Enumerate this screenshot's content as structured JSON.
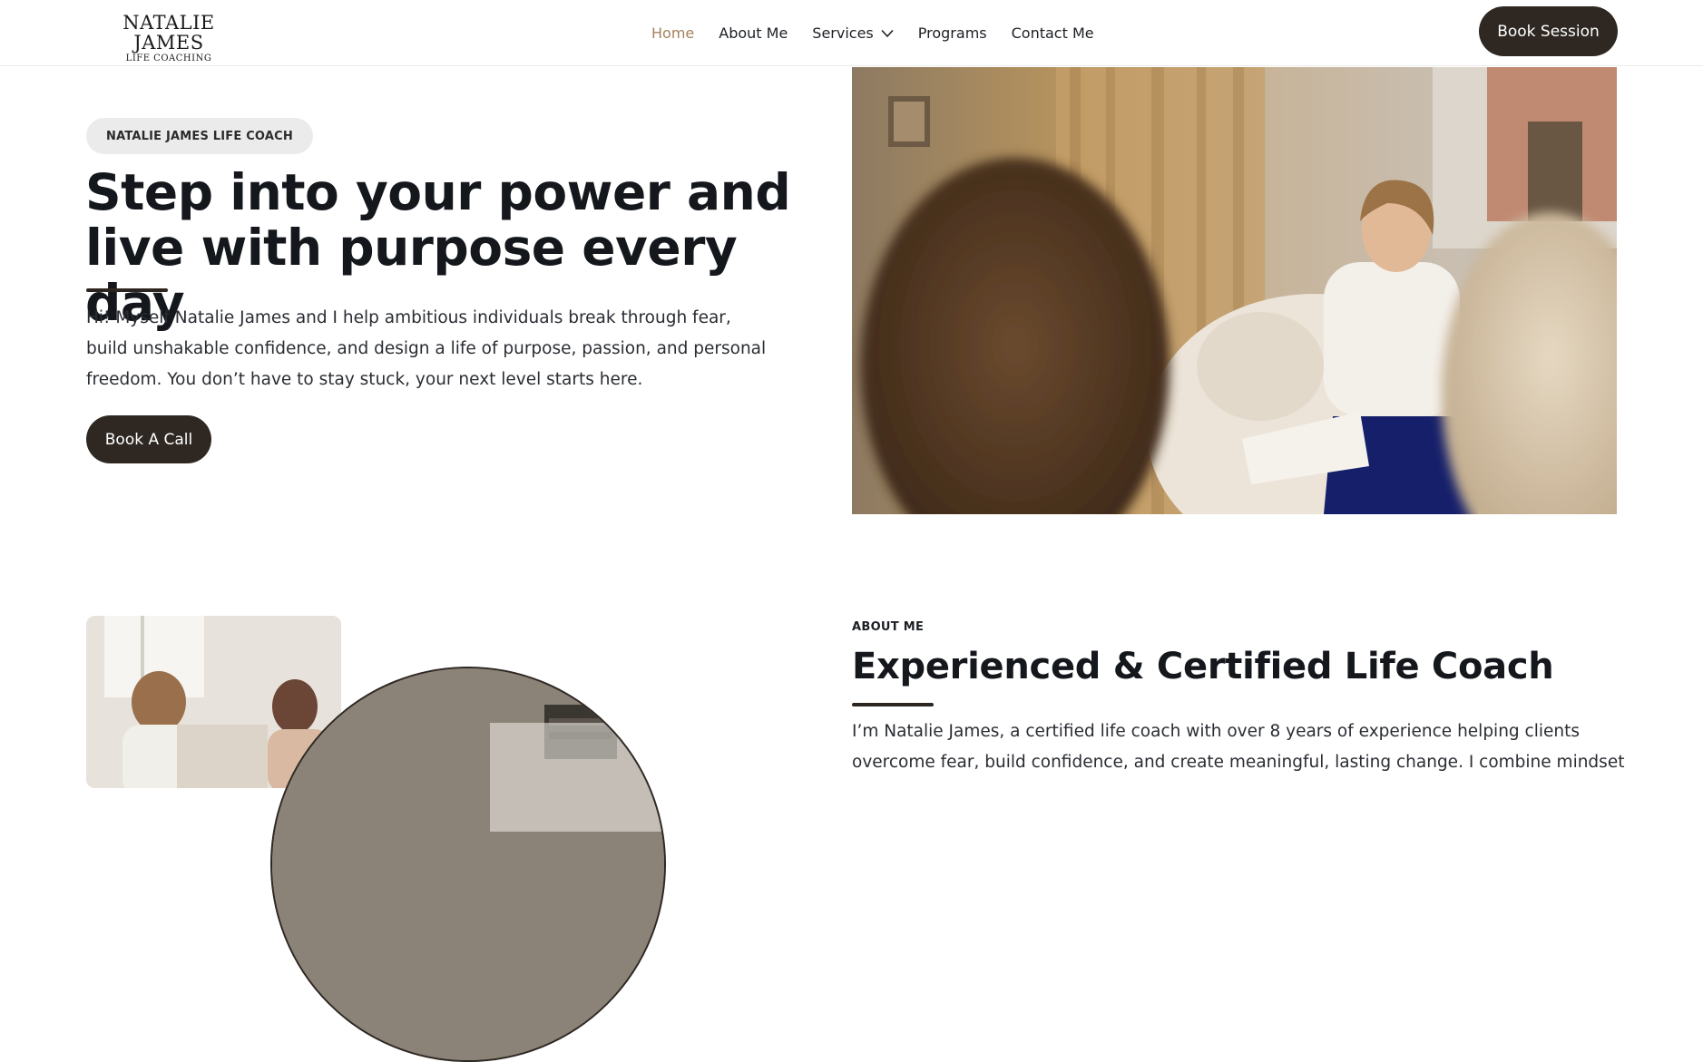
{
  "header": {
    "logo_name": "NATALIE JAMES",
    "logo_sub": "LIFE COACHING",
    "nav": {
      "home": "Home",
      "about": "About Me",
      "services": "Services",
      "programs": "Programs",
      "contact": "Contact Me"
    },
    "cta": "Book Session",
    "active_color": "#a5825e"
  },
  "hero": {
    "badge": "NATALIE JAMES LIFE COACH",
    "title_line1": "Step into your power and",
    "title_line2": "live with purpose every day",
    "text": "Hi! Myself Natalie James and I help ambitious individuals break through fear, build unshakable confidence, and design a life of purpose, passion, and personal freedom. You don’t have to stay stuck, your next level starts here.",
    "cta": "Book A Call"
  },
  "about": {
    "label": "ABOUT ME",
    "title": "Experienced & Certified Life Coach",
    "text": "I’m Natalie James, a certified life coach with over 8 years of experience helping clients overcome fear, build confidence, and create meaningful, lasting change. I combine mindset"
  },
  "colors": {
    "button_bg": "#2f2822",
    "badge_bg": "#ebebeb",
    "heading": "#14171c"
  }
}
